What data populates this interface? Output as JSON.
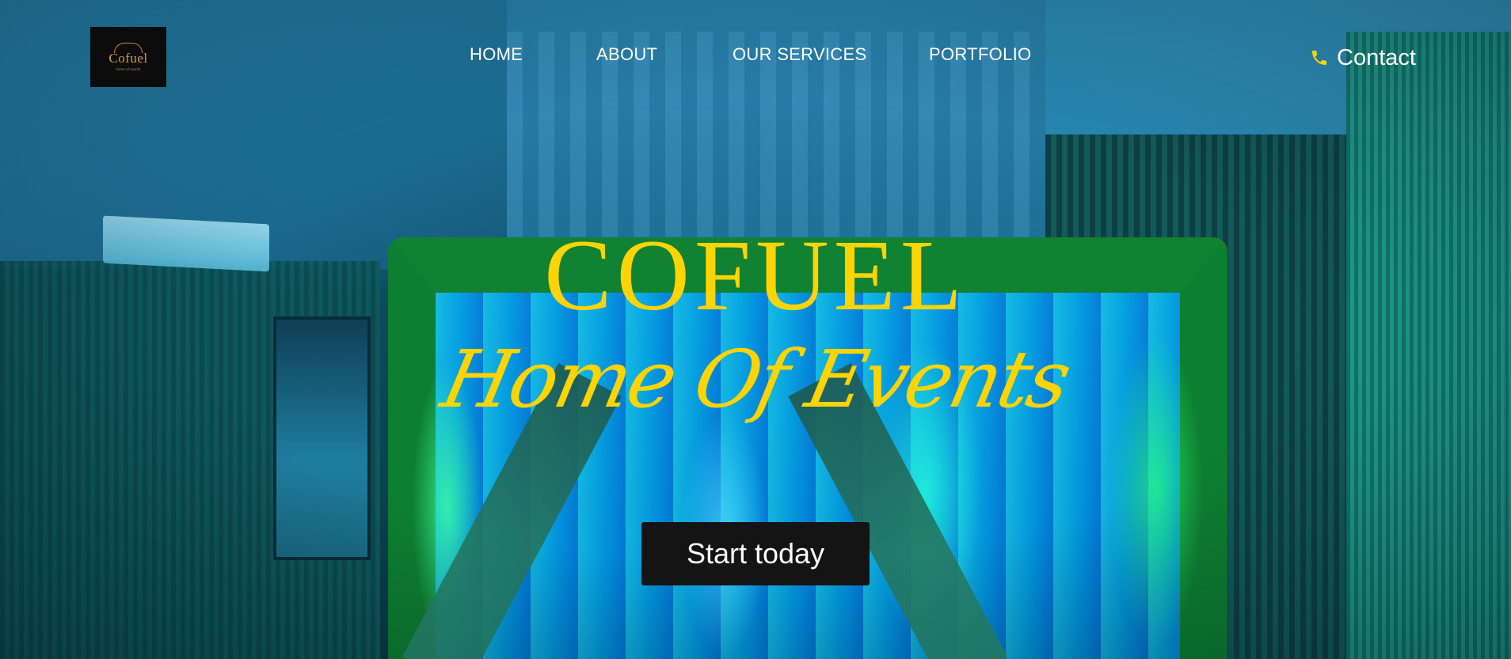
{
  "brand": {
    "logo_text": "Cofuel",
    "logo_tagline": "home of events"
  },
  "nav": {
    "items": [
      {
        "label": "HOME"
      },
      {
        "label": "ABOUT"
      },
      {
        "label": "OUR SERVICES"
      },
      {
        "label": "PORTFOLIO"
      }
    ],
    "contact_label": "Contact",
    "contact_icon": "phone-icon"
  },
  "hero": {
    "title": "COFUEL",
    "subtitle": "Home Of Events",
    "cta_label": "Start today"
  },
  "colors": {
    "accent": "#ffd400",
    "button_bg": "#141414",
    "nav_text": "#ffffff"
  }
}
